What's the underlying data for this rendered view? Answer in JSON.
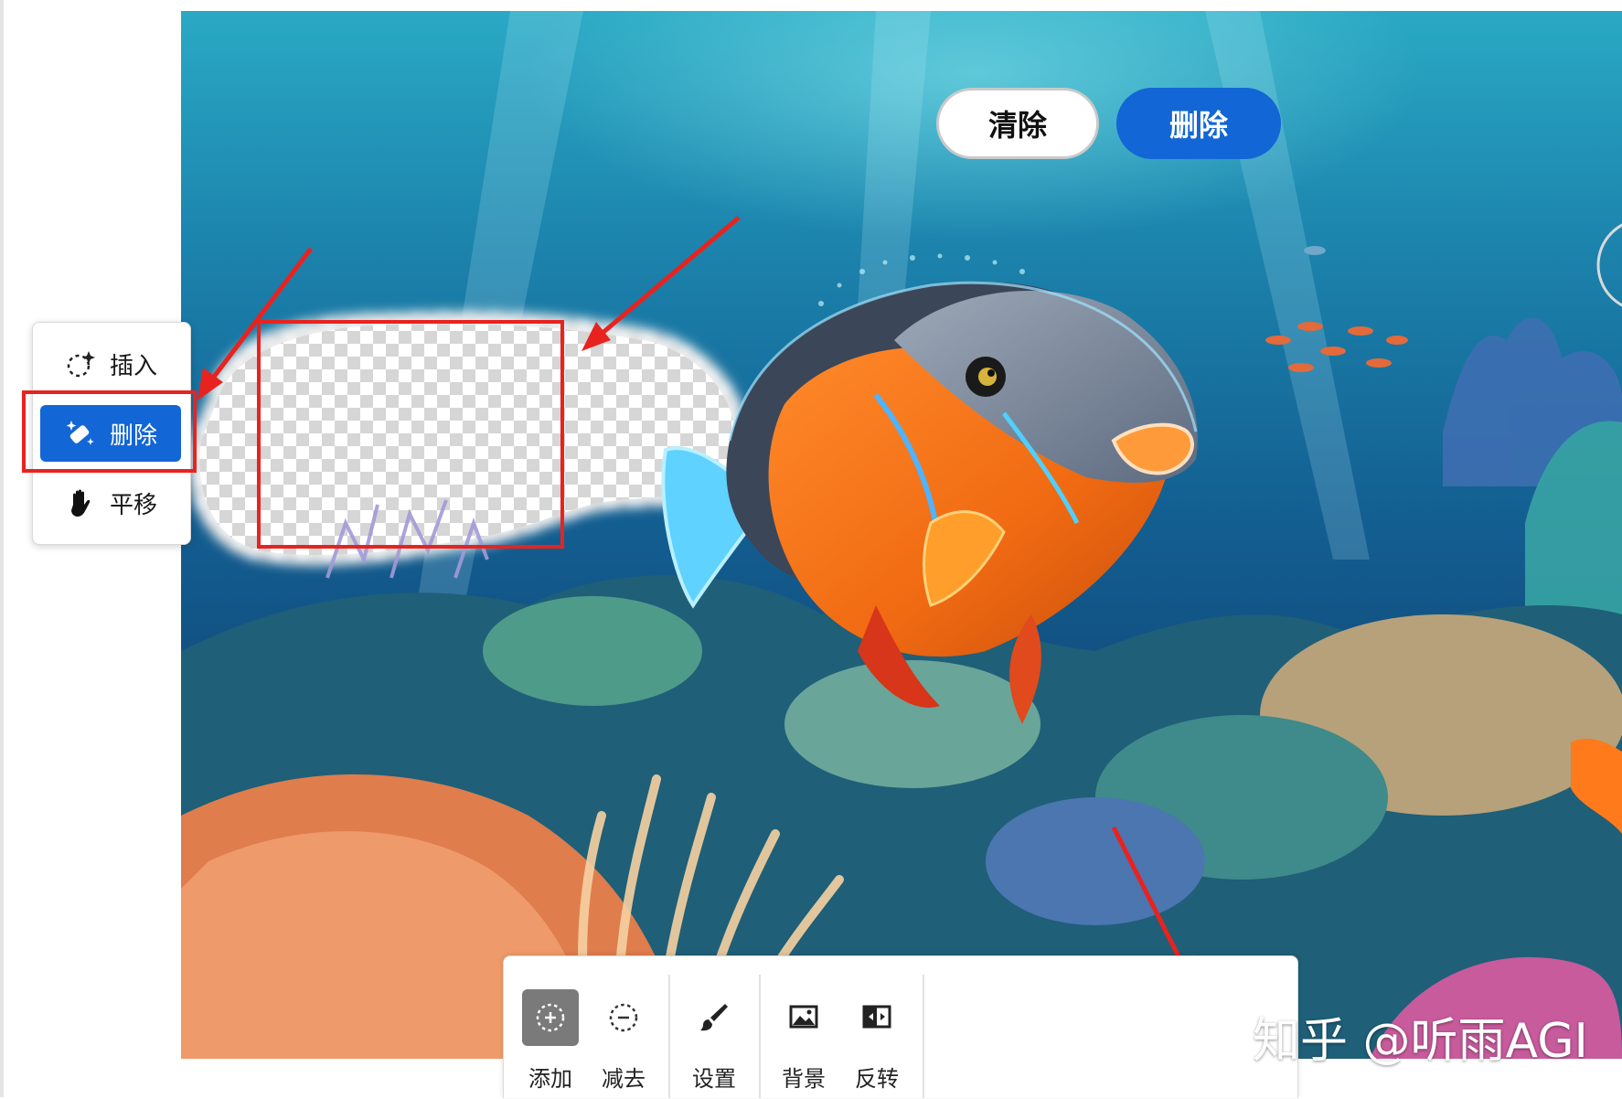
{
  "tool_panel": {
    "items": [
      {
        "label": "插入",
        "icon": "sparkle-insert-icon",
        "active": false
      },
      {
        "label": "删除",
        "icon": "magic-eraser-icon",
        "active": true
      },
      {
        "label": "平移",
        "icon": "hand-pan-icon",
        "active": false
      }
    ]
  },
  "bottom_toolbar": {
    "brush_tools": [
      {
        "label": "添加",
        "icon": "brush-add-icon",
        "selected": true
      },
      {
        "label": "减去",
        "icon": "brush-subtract-icon",
        "selected": false
      }
    ],
    "settings": {
      "label": "设置",
      "icon": "paintbrush-settings-icon"
    },
    "mask_tools": [
      {
        "label": "背景",
        "icon": "background-image-icon"
      },
      {
        "label": "反转",
        "icon": "invert-selection-icon"
      }
    ],
    "clear_button": "清除",
    "delete_button": "删除"
  },
  "watermark": "知乎 @听雨AGI",
  "colors": {
    "accent_blue": "#1266d6",
    "annotation_red": "#e8231f",
    "panel_bg": "#ffffff"
  }
}
